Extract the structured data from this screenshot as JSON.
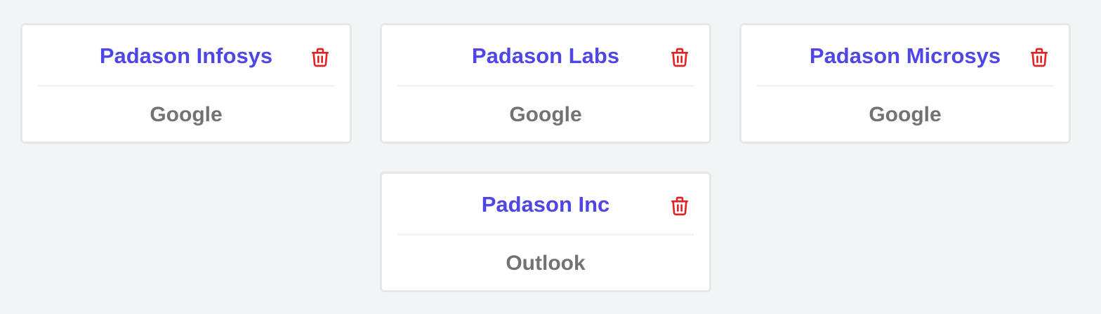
{
  "accounts": [
    {
      "name": "Padason Infosys",
      "provider": "Google",
      "delete_icon": "trash-icon"
    },
    {
      "name": "Padason Labs",
      "provider": "Google",
      "delete_icon": "trash-icon"
    },
    {
      "name": "Padason Microsys",
      "provider": "Google",
      "delete_icon": "trash-icon"
    },
    {
      "name": "Padason Inc",
      "provider": "Outlook",
      "delete_icon": "trash-icon"
    }
  ],
  "colors": {
    "background": "#f3f4f6",
    "card_border": "#e5e7eb",
    "title": "#4f46e5",
    "provider_text": "#737373",
    "delete_icon": "#dc2626"
  }
}
